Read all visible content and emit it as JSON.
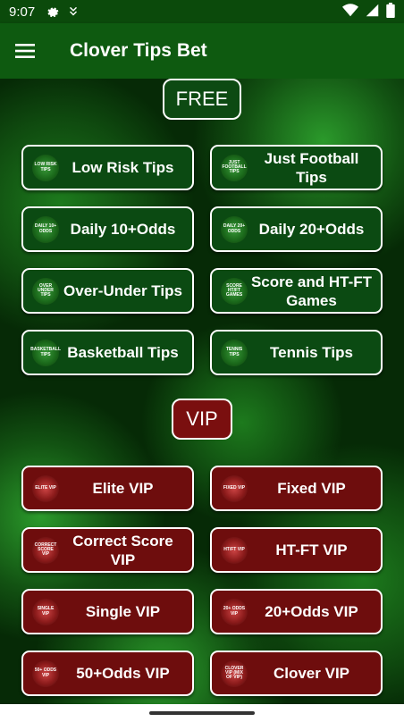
{
  "status": {
    "time": "9:07"
  },
  "app": {
    "title": "Clover Tips Bet"
  },
  "sections": {
    "free": "FREE",
    "vip": "VIP"
  },
  "free_buttons": [
    {
      "badge": "LOW RISK TIPS",
      "label": "Low Risk Tips"
    },
    {
      "badge": "JUST FOOTBALL TIPS",
      "label": "Just Football Tips"
    },
    {
      "badge": "DAILY 10+ ODDS",
      "label": "Daily 10+Odds"
    },
    {
      "badge": "DAILY 20+ ODDS",
      "label": "Daily 20+Odds"
    },
    {
      "badge": "OVER UNDER TIPS",
      "label": "Over-Under Tips"
    },
    {
      "badge": "SCORE HT/FT GAMES",
      "label": "Score and HT-FT Games"
    },
    {
      "badge": "BASKETBALL TIPS",
      "label": "Basketball Tips"
    },
    {
      "badge": "TENNIS TIPS",
      "label": "Tennis Tips"
    }
  ],
  "vip_buttons": [
    {
      "badge": "ELITE VIP",
      "label": "Elite VIP"
    },
    {
      "badge": "FIXED VIP",
      "label": "Fixed VIP"
    },
    {
      "badge": "CORRECT SCORE VIP",
      "label": "Correct Score VIP"
    },
    {
      "badge": "HT/FT VIP",
      "label": "HT-FT VIP"
    },
    {
      "badge": "SINGLE VIP",
      "label": "Single VIP"
    },
    {
      "badge": "20+ ODDS VIP",
      "label": "20+Odds VIP"
    },
    {
      "badge": "50+ ODDS VIP",
      "label": "50+Odds VIP"
    },
    {
      "badge": "CLOVER VIP (MIX OF VIP)",
      "label": "Clover VIP"
    }
  ]
}
